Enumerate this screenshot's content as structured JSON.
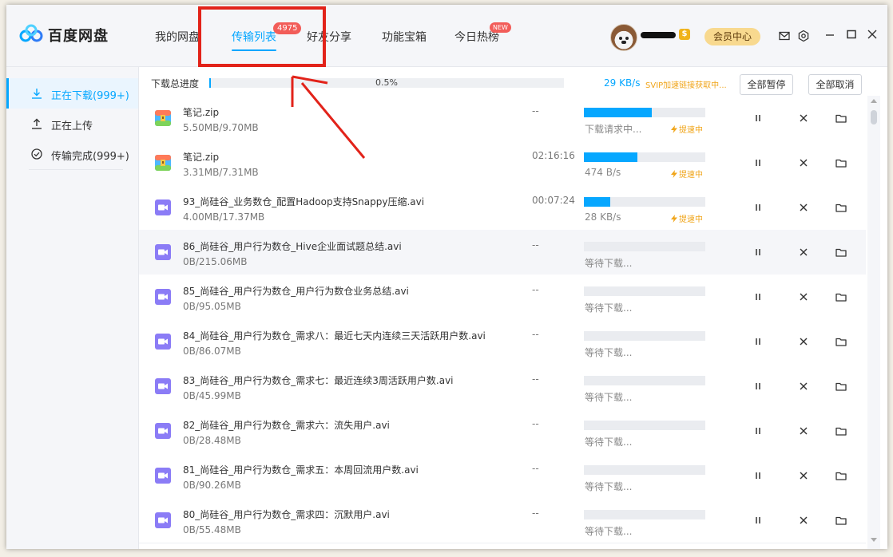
{
  "app": {
    "name": "百度网盘"
  },
  "nav": {
    "tabs": [
      {
        "label": "我的网盘"
      },
      {
        "label": "传输列表",
        "badge": "4975",
        "active": true
      },
      {
        "label": "好友分享"
      },
      {
        "label": "功能宝箱"
      },
      {
        "label": "今日热榜",
        "badge": "NEW"
      }
    ]
  },
  "user": {
    "vip_label": "$",
    "member_button": "会员中心"
  },
  "sidebar": {
    "items": [
      {
        "label": "正在下载(999+)",
        "icon": "download-icon",
        "active": true
      },
      {
        "label": "正在上传",
        "icon": "upload-icon"
      },
      {
        "label": "传输完成(999+)",
        "icon": "check-circle-icon"
      }
    ]
  },
  "summary": {
    "label": "下载总进度",
    "percent_text": "0.5%",
    "progress": 0.005,
    "speed": "29 KB/s",
    "svip_tip": "SVIP加速链接获取中...",
    "pause_all": "全部暂停",
    "cancel_all": "全部取消"
  },
  "boost_label": "提速中",
  "colors": {
    "accent": "#06a7ff",
    "boost": "#f0a51a",
    "badge": "#f25d59",
    "annotation": "#e2231a"
  },
  "transfers": [
    {
      "name": "笔记.zip",
      "size": "5.50MB/9.70MB",
      "eta": "--",
      "progress": 0.56,
      "status": "下载请求中...",
      "type": "zip",
      "boost": true
    },
    {
      "name": "笔记.zip",
      "size": "3.31MB/7.31MB",
      "eta": "02:16:16",
      "progress": 0.44,
      "status": "474 B/s",
      "type": "zip",
      "boost": true
    },
    {
      "name": "93_尚硅谷_业务数仓_配置Hadoop支持Snappy压缩.avi",
      "size": "4.00MB/17.37MB",
      "eta": "00:07:24",
      "progress": 0.22,
      "status": "28 KB/s",
      "type": "video",
      "boost": true
    },
    {
      "name": "86_尚硅谷_用户行为数仓_Hive企业面试题总结.avi",
      "size": "0B/215.06MB",
      "eta": "--",
      "progress": 0,
      "status": "等待下载...",
      "type": "video",
      "boost": false
    },
    {
      "name": "85_尚硅谷_用户行为数仓_用户行为数仓业务总结.avi",
      "size": "0B/95.05MB",
      "eta": "--",
      "progress": 0,
      "status": "等待下载...",
      "type": "video",
      "boost": false
    },
    {
      "name": "84_尚硅谷_用户行为数仓_需求八：最近七天内连续三天活跃用户数.avi",
      "size": "0B/86.07MB",
      "eta": "--",
      "progress": 0,
      "status": "等待下载...",
      "type": "video",
      "boost": false
    },
    {
      "name": "83_尚硅谷_用户行为数仓_需求七：最近连续3周活跃用户数.avi",
      "size": "0B/45.99MB",
      "eta": "--",
      "progress": 0,
      "status": "等待下载...",
      "type": "video",
      "boost": false
    },
    {
      "name": "82_尚硅谷_用户行为数仓_需求六：流失用户.avi",
      "size": "0B/28.48MB",
      "eta": "--",
      "progress": 0,
      "status": "等待下载...",
      "type": "video",
      "boost": false
    },
    {
      "name": "81_尚硅谷_用户行为数仓_需求五：本周回流用户数.avi",
      "size": "0B/90.26MB",
      "eta": "--",
      "progress": 0,
      "status": "等待下载...",
      "type": "video",
      "boost": false
    },
    {
      "name": "80_尚硅谷_用户行为数仓_需求四：沉默用户.avi",
      "size": "0B/55.48MB",
      "eta": "--",
      "progress": 0,
      "status": "等待下载...",
      "type": "video",
      "boost": false
    }
  ]
}
